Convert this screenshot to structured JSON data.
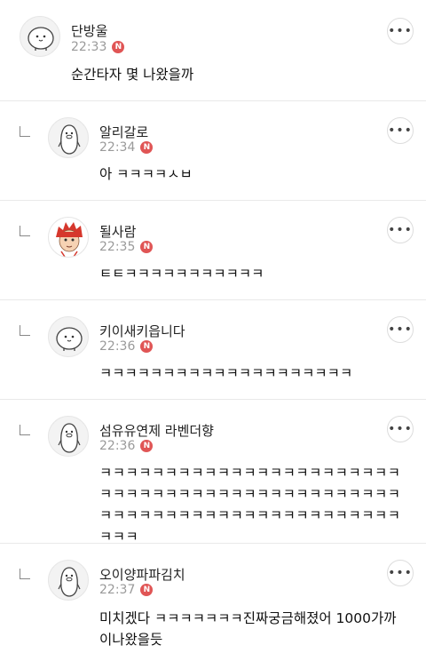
{
  "badge_label": "N",
  "more_label": "•••",
  "comments": [
    {
      "name": "단방울",
      "time": "22:33",
      "text": "순간타자 몇 나왔을까",
      "avatar": "blob-icon"
    },
    {
      "name": "알리갈로",
      "time": "22:34",
      "text": "아 ㅋㅋㅋㅋㅅㅂ",
      "avatar": "penguin-icon"
    },
    {
      "name": "될사람",
      "time": "22:35",
      "text": "ㅌㅌㅋㅋㅋㅋㅋㅋㅋㅋㅋㅋㅋ",
      "avatar": "red-hair-character-icon"
    },
    {
      "name": "키이새키읍니다",
      "time": "22:36",
      "text": "ㅋㅋㅋㅋㅋㅋㅋㅋㅋㅋㅋㅋㅋㅋㅋㅋㅋㅋㅋㅋ",
      "avatar": "blob-icon"
    },
    {
      "name": "섬유유연제 라벤더향",
      "time": "22:36",
      "text": "ㅋㅋㅋㅋㅋㅋㅋㅋㅋㅋㅋㅋㅋㅋㅋㅋㅋㅋㅋㅋㅋㅋㅋㅋㅋㅋㅋㅋㅋㅋㅋㅋㅋㅋㅋㅋㅋㅋㅋㅋㅋㅋㅋㅋㅋㅋㅋㅋㅋㅋㅋㅋㅋㅋㅋㅋㅋㅋㅋㅋㅋㅋㅋㅋㅋㅋㅋㅋㅋㅋㅋㅋ",
      "avatar": "penguin-icon"
    },
    {
      "name": "오이양파파김치",
      "time": "22:37",
      "text": "미치겠다 ㅋㅋㅋㅋㅋㅋㅋ진짜궁금해졌어 1000가까이나왔을듯",
      "avatar": "penguin-icon"
    }
  ]
}
